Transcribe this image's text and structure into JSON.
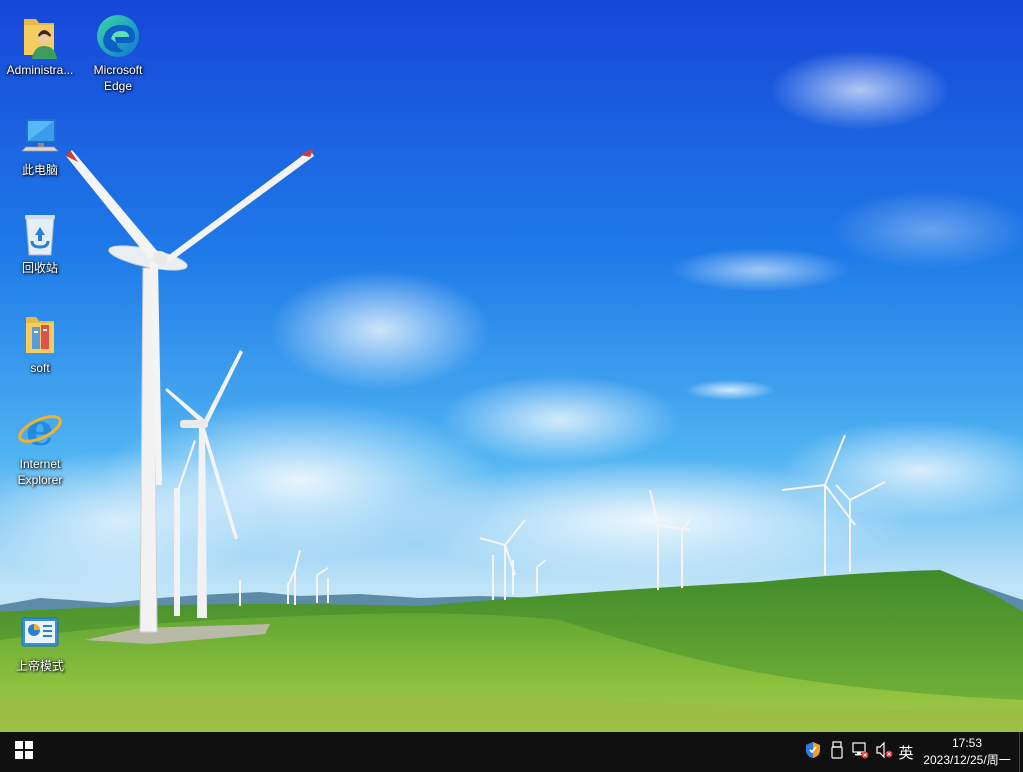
{
  "desktop": {
    "icons": [
      {
        "label": "Administra...",
        "icon": "user-folder-icon"
      },
      {
        "label": "Microsoft Edge",
        "icon": "edge-icon"
      },
      {
        "label": "此电脑",
        "icon": "computer-icon"
      },
      {
        "label": "回收站",
        "icon": "recycle-bin-icon"
      },
      {
        "label": "soft",
        "icon": "folder-icon"
      },
      {
        "label": "Internet Explorer",
        "icon": "ie-icon"
      },
      {
        "label": "上帝模式",
        "icon": "control-panel-icon"
      }
    ]
  },
  "taskbar": {
    "start_icon": "windows-logo-icon",
    "tray": {
      "security": "shield-icon",
      "usb": "usb-drive-icon",
      "network": "network-disconnected-icon",
      "volume": "volume-muted-icon",
      "ime_label": "英"
    },
    "clock": {
      "time": "17:53",
      "date": "2023/12/25/周一"
    }
  },
  "colors": {
    "sky_top": "#1f5ee8",
    "sky_mid": "#2d8cf0",
    "grass": "#5c9e2f",
    "taskbar": "#101010"
  }
}
